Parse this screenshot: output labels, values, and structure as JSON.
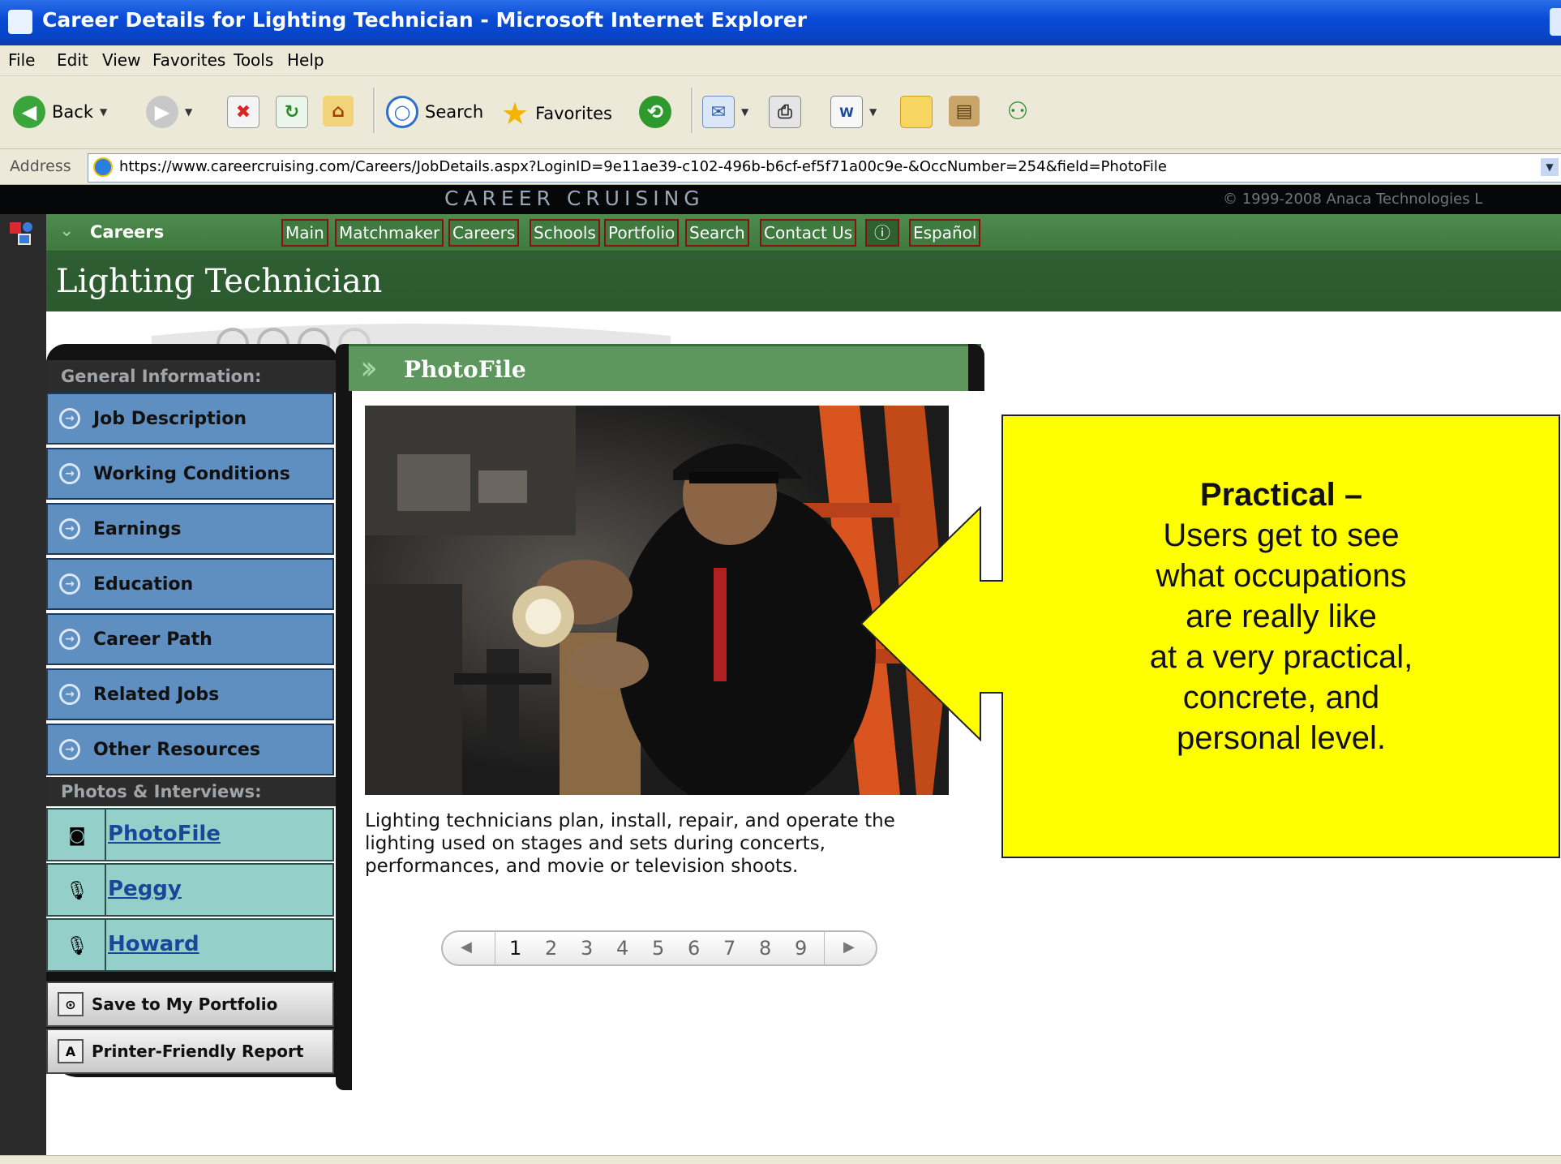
{
  "window": {
    "title": "Career Details for Lighting Technician - Microsoft Internet Explorer"
  },
  "menu": [
    "File",
    "Edit",
    "View",
    "Favorites",
    "Tools",
    "Help"
  ],
  "toolbar": {
    "back": "Back",
    "search": "Search",
    "favorites": "Favorites"
  },
  "address": {
    "label": "Address",
    "url": "https://www.careercruising.com/Careers/JobDetails.aspx?LoginID=9e11ae39-c102-496b-b6cf-ef5f71a00c9e-&OccNumber=254&field=PhotoFile"
  },
  "site": {
    "brand": "CAREER CRUISING",
    "copyright": "© 1999-2008 Anaca Technologies L",
    "breadcrumb": "Careers",
    "nav": [
      "Main",
      "Matchmaker",
      "Careers",
      "Schools",
      "Portfolio",
      "Search",
      "Contact Us",
      "Español"
    ],
    "page_title": "Lighting Technician"
  },
  "sidebar": {
    "general_header": "General Information:",
    "general_items": [
      "Job Description",
      "Working Conditions",
      "Earnings",
      "Education",
      "Career Path",
      "Related Jobs",
      "Other Resources"
    ],
    "photos_header": "Photos & Interviews:",
    "photo_items": [
      "PhotoFile",
      "Peggy",
      "Howard"
    ],
    "save_label": "Save to My Portfolio",
    "print_label": "Printer-Friendly Report"
  },
  "content": {
    "header": "PhotoFile",
    "caption": "Lighting technicians plan, install, repair, and operate the lighting used on stages and sets during concerts, performances, and movie or television shoots.",
    "pages": [
      "1",
      "2",
      "3",
      "4",
      "5",
      "6",
      "7",
      "8",
      "9"
    ],
    "current_page": 1
  },
  "callout": {
    "heading": "Practical –",
    "lines": [
      "Users get to see",
      "what occupations",
      "are really like",
      "at a very practical,",
      "concrete, and",
      "personal level."
    ]
  }
}
